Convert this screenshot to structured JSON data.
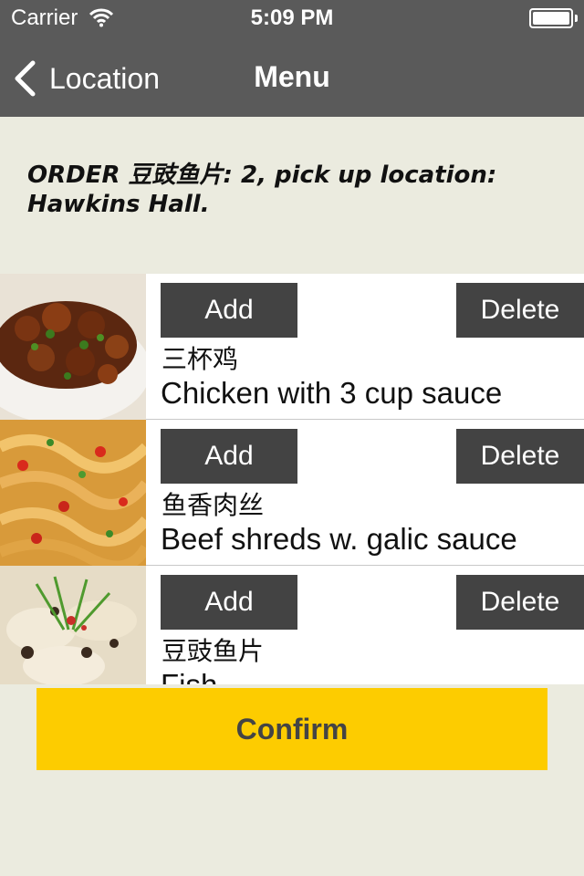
{
  "status_bar": {
    "carrier": "Carrier",
    "time": "5:09 PM",
    "icons": [
      "wifi-icon",
      "battery-icon"
    ]
  },
  "nav": {
    "back_label": "Location",
    "title": "Menu",
    "icons": [
      "chevron-left-icon"
    ]
  },
  "order_text": "ORDER 豆豉鱼片: 2, pick up location: Hawkins Hall.",
  "menu_items": [
    {
      "name_cn": "三杯鸡",
      "name_en": "Chicken with 3 cup sauce",
      "add_label": "Add",
      "delete_label": "Delete"
    },
    {
      "name_cn": "鱼香肉丝",
      "name_en": "Beef shreds w. galic sauce",
      "add_label": "Add",
      "delete_label": "Delete"
    },
    {
      "name_cn": "豆豉鱼片",
      "name_en": "Fish",
      "add_label": "Add",
      "delete_label": "Delete"
    }
  ],
  "confirm_label": "Confirm",
  "colors": {
    "navbar": "#5a5a5a",
    "background": "#ebebdf",
    "button": "#434343",
    "confirm": "#fdcc00",
    "confirm_text": "#444444"
  }
}
